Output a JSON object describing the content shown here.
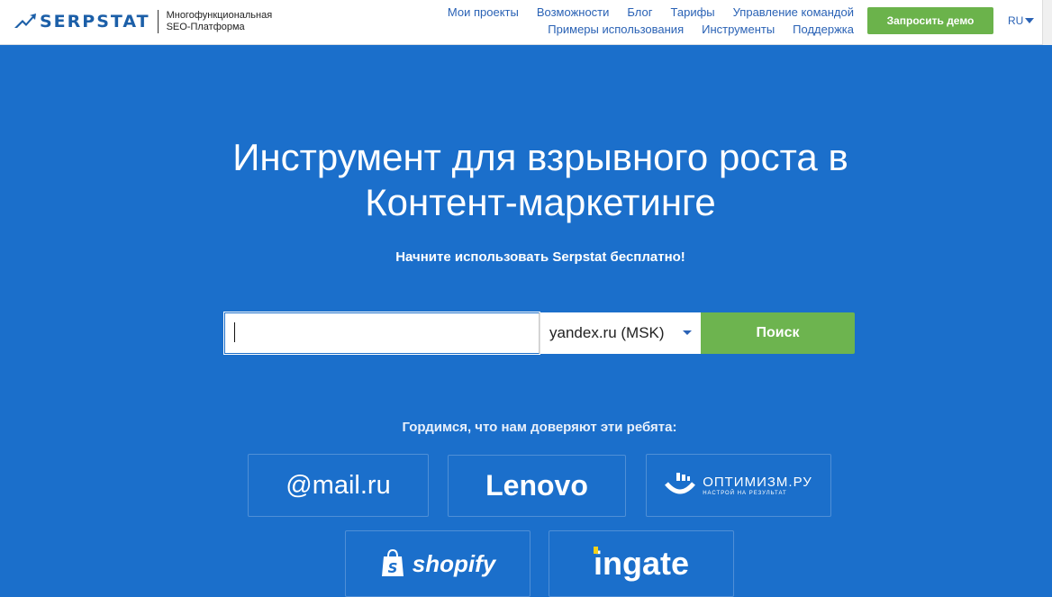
{
  "header": {
    "logo_text": "SERPSTAT",
    "tagline_line1": "Многофункциональная",
    "tagline_line2": "SEO-Платформа",
    "nav_row1": [
      "Мои проекты",
      "Возможности",
      "Блог",
      "Тарифы",
      "Управление командой"
    ],
    "nav_row2": [
      "Примеры использования",
      "Инструменты",
      "Поддержка"
    ],
    "demo_button": "Запросить демо",
    "language": "RU"
  },
  "hero": {
    "title_line1": "Инструмент для взрывного роста в",
    "title_line2": "Контент-маркетинге",
    "subtitle": "Начните использовать Serpstat бесплатно!"
  },
  "search": {
    "value": "",
    "engine": "yandex.ru (MSK)",
    "button": "Поиск"
  },
  "trust": {
    "heading": "Гордимся, что нам доверяют эти ребята:",
    "logos": {
      "mail": "@mail.ru",
      "lenovo": "Lenovo",
      "optimizm": "ОПТИМИЗМ.РУ",
      "optimizm_tag": "НАСТРОЙ НА РЕЗУЛЬТАТ",
      "shopify": "shopify",
      "ingate": "ingate"
    }
  },
  "colors": {
    "hero_bg": "#1b6fcb",
    "accent_green": "#6db44f",
    "link_blue": "#2a62b5"
  }
}
